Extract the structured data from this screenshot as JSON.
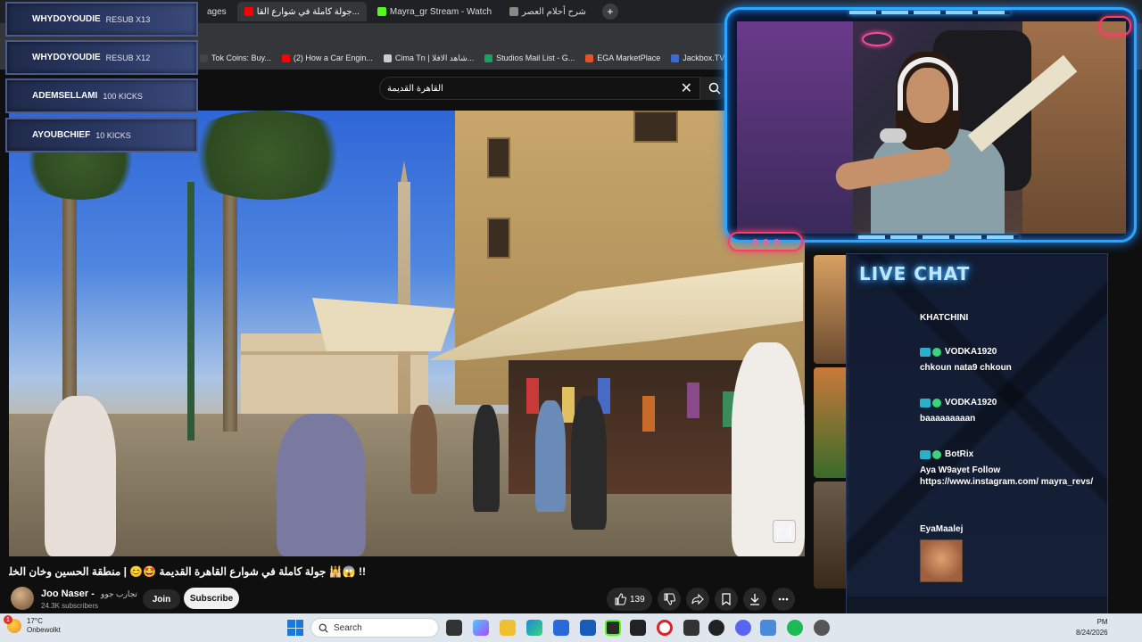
{
  "browser": {
    "tabs": [
      {
        "label": "ages",
        "active": false,
        "favicon_color": "#3a3a3a"
      },
      {
        "label": "جولة كاملة في شوارع القا...",
        "active": true,
        "favicon_color": "#ff0000"
      },
      {
        "label": "Mayra_gr Stream - Watch",
        "active": false,
        "favicon_color": "#53fc18"
      },
      {
        "label": "شرح أحلام العصر",
        "active": false,
        "favicon_color": "#888888"
      }
    ],
    "new_tab": "+",
    "bookmarks": [
      {
        "label": "Tok Coins: Buy...",
        "color": "#444444"
      },
      {
        "label": "(2) How a Car Engin...",
        "color": "#ff0000"
      },
      {
        "label": "Cima Tn | شاهد الافلا...",
        "color": "#cccccc"
      },
      {
        "label": "Studios Mail List - G...",
        "color": "#1aa260"
      },
      {
        "label": "EGA MarketPlace",
        "color": "#e8502a"
      },
      {
        "label": "Jackbox.TV",
        "color": "#3a6ad4"
      }
    ]
  },
  "youtube": {
    "search": {
      "value": "القاهرة القديمة",
      "clear": "✕"
    },
    "video": {
      "title": "!! 😱🕌 جولة كاملة في شوارع القاهرة القديمة 🤩😊 | منطقة الحسين وخان الخليلي"
    },
    "channel": {
      "name": "Joo Naser -",
      "name_ar": "تجارب جوو",
      "subscribers": "24.3K subscribers",
      "join_label": "Join",
      "subscribe_label": "Subscribe"
    },
    "actions": {
      "likes": "139"
    }
  },
  "overlay": {
    "alerts": [
      {
        "user": "WHYDOYOUDIE",
        "what": "RESUB X13"
      },
      {
        "user": "WHYDOYOUDIE",
        "what": "RESUB X12"
      },
      {
        "user": "ADEMSELLAMI",
        "what": "100 KICKS"
      },
      {
        "user": "AYOUBCHIEF",
        "what": "10 KICKS"
      }
    ],
    "chat": {
      "title": "LIVE CHAT",
      "messages": [
        {
          "user": "KHATCHINI",
          "text": "",
          "badges": false
        },
        {
          "user": "VODKA1920",
          "text": "chkoun nata9 chkoun",
          "badges": true
        },
        {
          "user": "VODKA1920",
          "text": "baaaaaaaaan",
          "badges": true
        },
        {
          "user": "BotRix",
          "text": "Aya W9ayet Follow https://www.instagram.com/ mayra_revs/",
          "badges": true
        },
        {
          "user": "EyaMaalej",
          "text": "",
          "badges": false
        }
      ]
    }
  },
  "taskbar": {
    "weather": {
      "temp": "17°C",
      "desc": "Onbewolkt"
    },
    "search_placeholder": "Search",
    "clock": {
      "time": "PM",
      "date": "8/24/2026"
    }
  },
  "colors": {
    "accent_neon": "#2aa6ff",
    "neon_pink": "#ff3a6a",
    "youtube_red": "#ff0000"
  }
}
